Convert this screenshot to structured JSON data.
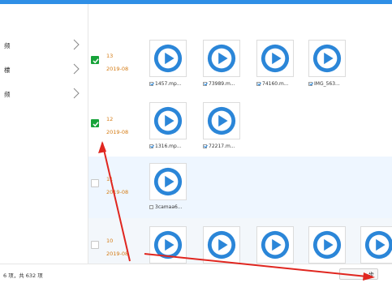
{
  "sidebar": {
    "items": [
      {
        "label": "频"
      },
      {
        "label": "檬"
      },
      {
        "label": "频"
      }
    ]
  },
  "groups": [
    {
      "day": "13",
      "date": "2019-08",
      "checked": true,
      "files": [
        {
          "name": "1457.mp...",
          "checked": true
        },
        {
          "name": "73989.m...",
          "checked": true
        },
        {
          "name": "74160.m...",
          "checked": true
        },
        {
          "name": "IMG_563...",
          "checked": true
        }
      ]
    },
    {
      "day": "12",
      "date": "2019-08",
      "checked": true,
      "files": [
        {
          "name": "1316.mp...",
          "checked": true
        },
        {
          "name": "72217.m...",
          "checked": true
        }
      ]
    },
    {
      "day": "11",
      "date": "2019-08",
      "checked": false,
      "files": [
        {
          "name": "3camaa6...",
          "checked": false
        }
      ]
    },
    {
      "day": "10",
      "date": "2019-08",
      "checked": false,
      "files": [
        {
          "name": "",
          "checked": false
        },
        {
          "name": "",
          "checked": false
        },
        {
          "name": "",
          "checked": false
        },
        {
          "name": "",
          "checked": false
        },
        {
          "name": "",
          "checked": false
        }
      ]
    }
  ],
  "footer": {
    "status": "6 项，共 632 项",
    "next_label": "步"
  },
  "colors": {
    "accent": "#2f8fe6",
    "checkbox_on": "#17a33a",
    "date_text": "#d47a12",
    "annotation_arrow": "#e0261f"
  }
}
